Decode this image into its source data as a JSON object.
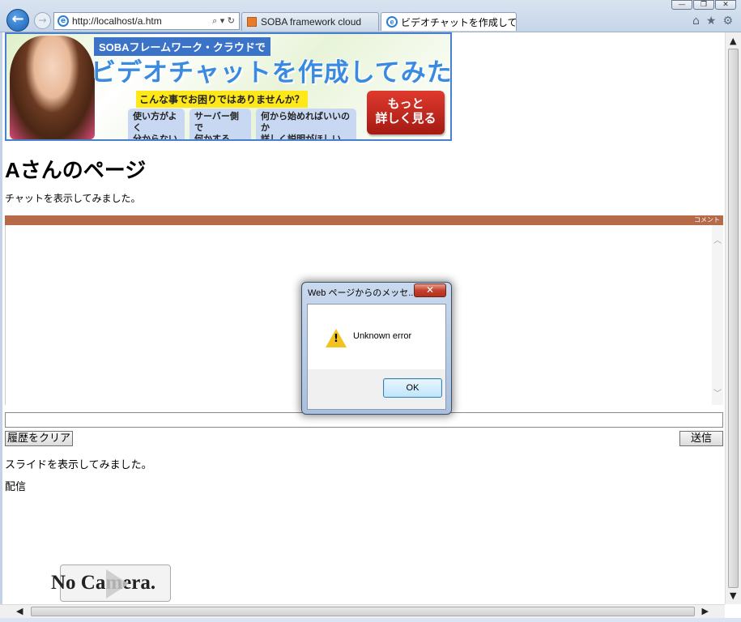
{
  "window": {
    "minimize_label": "—",
    "restore_label": "❐",
    "close_label": "✕"
  },
  "browser": {
    "back_icon": "back-arrow-icon",
    "back_glyph": "←",
    "forward_glyph": "→",
    "address": "http://localhost/a.htm",
    "address_tools": "⌕ ▾ ↻",
    "tabs": [
      {
        "label": "SOBA framework cloud",
        "close": ""
      },
      {
        "label": "ビデオチャットを作成して...",
        "close": "✕"
      }
    ],
    "toolbar_icons": [
      "⌂",
      "★",
      "⚙"
    ]
  },
  "banner": {
    "subtitle": "SOBAフレームワーク・クラウドで",
    "title": "ビデオチャットを作成してみた",
    "question": "こんな事でお困りではありませんか？",
    "pills": [
      "使い方がよく\n分からない",
      "サーバー側で\n何かするの？",
      "何から始めればいいのか\n詳しく説明がほしい"
    ],
    "cta": "もっと\n詳しく見る"
  },
  "page": {
    "title": "Aさんのページ",
    "chat_description": "チャットを表示してみました。",
    "chat_bar_label": "コメント",
    "chat_input_value": "",
    "clear_button": "履歴をクリア",
    "send_button": "送信",
    "slide_description": "スライドを表示してみました。",
    "broadcast_label": "配信",
    "camera_text": "No Camera."
  },
  "dialog": {
    "title": "Web ページからのメッセ...",
    "close_glyph": "✕",
    "message": "Unknown error",
    "ok_button": "OK",
    "icon": "warning-icon"
  },
  "colors": {
    "chat_bar": "#b56a48",
    "banner_border": "#4a7fd0",
    "cta": "#c8281e",
    "warning": "#f2c221"
  }
}
